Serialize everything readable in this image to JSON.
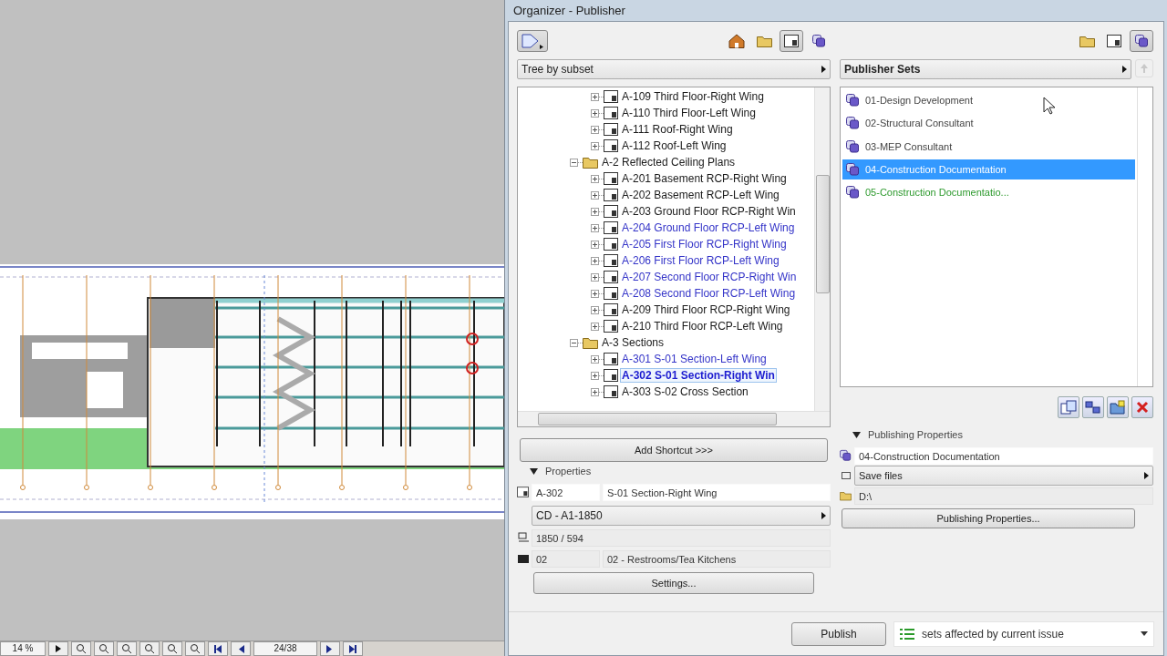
{
  "canvas": {
    "zoom": "14 %",
    "page": "24/38"
  },
  "window": {
    "title": "Organizer - Publisher"
  },
  "left_pane": {
    "view_buttons": [
      {
        "kind": "house",
        "selected": false
      },
      {
        "kind": "folder",
        "selected": false
      },
      {
        "kind": "sheet",
        "selected": true
      },
      {
        "kind": "set",
        "selected": false
      }
    ],
    "view_mode": "Tree by subset",
    "tree": [
      {
        "kind": "continued",
        "children": [
          {
            "kind": "sheet",
            "label": "A-109 Third Floor-Right Wing",
            "expanded": false,
            "selected": false,
            "color": "#1a1a1a"
          },
          {
            "kind": "sheet",
            "label": "A-110 Third Floor-Left Wing",
            "expanded": false,
            "selected": false,
            "color": "#1a1a1a"
          },
          {
            "kind": "sheet",
            "label": "A-111 Roof-Right Wing",
            "expanded": false,
            "selected": false,
            "color": "#1a1a1a"
          },
          {
            "kind": "sheet",
            "label": "A-112 Roof-Left Wing",
            "expanded": false,
            "selected": false,
            "color": "#1a1a1a"
          }
        ]
      },
      {
        "kind": "group",
        "label": "A-2 Reflected Ceiling Plans",
        "expanded": true,
        "selected": false,
        "color": "#1a1a1a",
        "children": [
          {
            "kind": "sheet",
            "label": "A-201 Basement RCP-Right Wing",
            "expanded": false,
            "selected": false,
            "color": "#1a1a1a"
          },
          {
            "kind": "sheet",
            "label": "A-202 Basement RCP-Left Wing",
            "expanded": false,
            "selected": false,
            "color": "#1a1a1a"
          },
          {
            "kind": "sheet",
            "label": "A-203 Ground Floor RCP-Right Win",
            "expanded": false,
            "selected": false,
            "color": "#1a1a1a"
          },
          {
            "kind": "sheet",
            "label": "A-204 Ground Floor RCP-Left Wing",
            "expanded": false,
            "selected": false,
            "color": "#3434c8"
          },
          {
            "kind": "sheet",
            "label": "A-205 First Floor RCP-Right Wing",
            "expanded": false,
            "selected": false,
            "color": "#3434c8"
          },
          {
            "kind": "sheet",
            "label": "A-206 First Floor RCP-Left Wing",
            "expanded": false,
            "selected": false,
            "color": "#3434c8"
          },
          {
            "kind": "sheet",
            "label": "A-207 Second Floor RCP-Right Win",
            "expanded": false,
            "selected": false,
            "color": "#3434c8"
          },
          {
            "kind": "sheet",
            "label": "A-208 Second Floor RCP-Left Wing",
            "expanded": false,
            "selected": false,
            "color": "#3434c8"
          },
          {
            "kind": "sheet",
            "label": "A-209 Third Floor RCP-Right Wing",
            "expanded": false,
            "selected": false,
            "color": "#1a1a1a"
          },
          {
            "kind": "sheet",
            "label": "A-210 Third Floor RCP-Left Wing",
            "expanded": false,
            "selected": false,
            "color": "#1a1a1a"
          }
        ]
      },
      {
        "kind": "group",
        "label": "A-3 Sections",
        "expanded": true,
        "selected": false,
        "color": "#1a1a1a",
        "children": [
          {
            "kind": "sheet",
            "label": "A-301 S-01 Section-Left Wing",
            "expanded": false,
            "selected": false,
            "color": "#3434c8"
          },
          {
            "kind": "sheet",
            "label": "A-302 S-01 Section-Right Win",
            "expanded": false,
            "selected": true,
            "color": "#1c1cd0"
          },
          {
            "kind": "sheet",
            "label": "A-303 S-02 Cross Section",
            "expanded": false,
            "selected": false,
            "color": "#1a1a1a"
          }
        ]
      }
    ],
    "add_button": "Add Shortcut >>>",
    "properties": {
      "title": "Properties",
      "expanded": true,
      "id": "A-302",
      "name": "S-01 Section-Right Wing",
      "layout": "CD - A1-1850",
      "size": "1850 / 594",
      "subset_id": "02",
      "subset_name": "02 - Restrooms/Tea Kitchens",
      "button": "Settings..."
    }
  },
  "right_pane": {
    "view_buttons": [
      {
        "kind": "folder",
        "selected": false
      },
      {
        "kind": "sheet",
        "selected": false
      },
      {
        "kind": "set",
        "selected": true
      }
    ],
    "header": "Publisher Sets",
    "sets": [
      {
        "label": "01-Design Development",
        "selected": false,
        "color": "#444444"
      },
      {
        "label": "02-Structural Consultant",
        "selected": false,
        "color": "#444444"
      },
      {
        "label": "03-MEP Consultant",
        "selected": false,
        "color": "#444444"
      },
      {
        "label": "04-Construction Documentation",
        "selected": true
      },
      {
        "label": "05-Construction Documentatio...",
        "selected": false,
        "color": "#2e9a2e"
      }
    ],
    "actions": [
      {
        "kind": "new-set"
      },
      {
        "kind": "link"
      },
      {
        "kind": "new-folder"
      },
      {
        "kind": "delete"
      }
    ],
    "publishing": {
      "title": "Publishing Properties",
      "expanded": true,
      "name": "04-Construction Documentation",
      "mode": "Save files",
      "path": "D:\\",
      "button": "Publishing Properties..."
    }
  },
  "footer": {
    "publish": "Publish",
    "filter": "sets affected by current issue"
  }
}
